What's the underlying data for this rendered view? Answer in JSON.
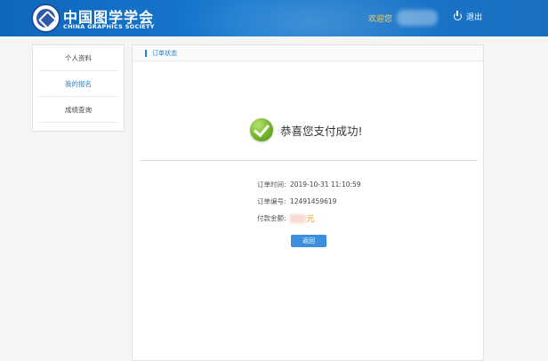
{
  "header": {
    "logo_cn": "中国图学学会",
    "logo_en": "CHINA GRAPHICS SOCIETY",
    "welcome": "欢迎您",
    "logout": "退出"
  },
  "sidebar": {
    "items": [
      {
        "label": "个人资料",
        "active": false
      },
      {
        "label": "我的报名",
        "active": true
      },
      {
        "label": "成绩查询",
        "active": false
      }
    ]
  },
  "panel": {
    "title": "订单状态",
    "success_message": "恭喜您支付成功!",
    "order_time_label": "订单时间:",
    "order_time": "2019-10-31 11:10:59",
    "order_no_label": "订单编号:",
    "order_no": "12491459619",
    "amount_label": "付款金额:",
    "amount_unit": "元",
    "back_button": "返回"
  },
  "colors": {
    "header_bg": "#1679cf",
    "accent": "#1f85d8",
    "success_green": "#72b52a",
    "amount_orange": "#f08a1c",
    "welcome_yellow": "#f3d36a"
  },
  "icons": [
    "emblem-logo",
    "power-icon",
    "check-circle-icon"
  ]
}
